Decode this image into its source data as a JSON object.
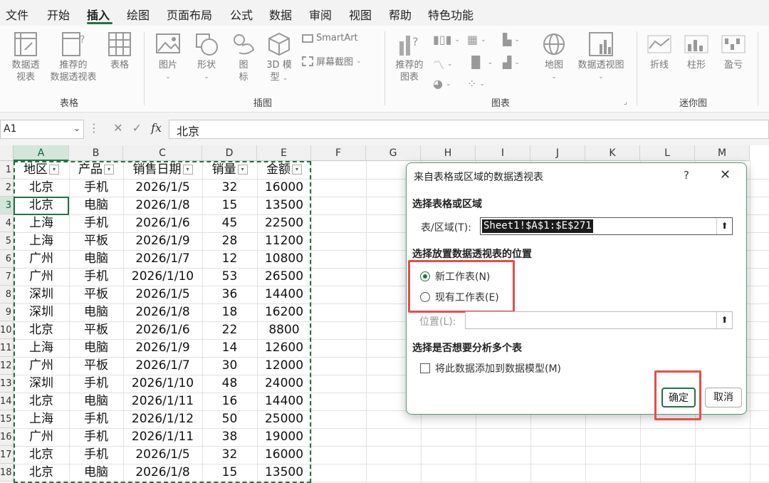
{
  "menu": {
    "tabs": [
      "文件",
      "开始",
      "插入",
      "绘图",
      "页面布局",
      "公式",
      "数据",
      "审阅",
      "视图",
      "帮助",
      "特色功能"
    ],
    "active_index": 2
  },
  "ribbon": {
    "groups": {
      "table": {
        "label": "表格",
        "pivot_line1": "数据透",
        "pivot_line2": "视表",
        "recommended_line1": "推荐的",
        "recommended_line2": "数据透视表",
        "table": "表格"
      },
      "illustrations": {
        "label": "插图",
        "picture": "图片",
        "shapes": "形状",
        "icons_line1": "图",
        "icons_line2": "标",
        "model3d_line1": "3D 模",
        "model3d_line2": "型",
        "smartart": "SmartArt",
        "screenshot": "屏幕截图"
      },
      "charts": {
        "label": "图表",
        "recommended_line1": "推荐的",
        "recommended_line2": "图表",
        "map": "地图",
        "pivot_chart": "数据透视图"
      },
      "sparklines": {
        "label": "迷你图",
        "line": "折线",
        "column": "柱形",
        "winloss": "盈亏"
      }
    }
  },
  "formula_bar": {
    "name_box": "A1",
    "fx": "fx",
    "value": "北京"
  },
  "sheet": {
    "columns": [
      "A",
      "B",
      "C",
      "D",
      "E",
      "F",
      "G",
      "H",
      "I",
      "J",
      "K",
      "L",
      "M"
    ],
    "row_numbers": [
      "1",
      "2",
      "3",
      "4",
      "5",
      "6",
      "7",
      "8",
      "9",
      "10",
      "11",
      "12",
      "13",
      "14",
      "15",
      "16",
      "17",
      "18"
    ],
    "headers": [
      "地区",
      "产品",
      "销售日期",
      "销量",
      "金额"
    ],
    "rows": [
      [
        "北京",
        "手机",
        "2026/1/5",
        "32",
        "16000"
      ],
      [
        "北京",
        "电脑",
        "2026/1/8",
        "15",
        "13500"
      ],
      [
        "上海",
        "手机",
        "2026/1/6",
        "45",
        "22500"
      ],
      [
        "上海",
        "平板",
        "2026/1/9",
        "28",
        "11200"
      ],
      [
        "广州",
        "电脑",
        "2026/1/7",
        "12",
        "10800"
      ],
      [
        "广州",
        "手机",
        "2026/1/10",
        "53",
        "26500"
      ],
      [
        "深圳",
        "平板",
        "2026/1/5",
        "36",
        "14400"
      ],
      [
        "深圳",
        "电脑",
        "2026/1/8",
        "18",
        "16200"
      ],
      [
        "北京",
        "平板",
        "2026/1/6",
        "22",
        "8800"
      ],
      [
        "上海",
        "电脑",
        "2026/1/9",
        "14",
        "12600"
      ],
      [
        "广州",
        "平板",
        "2026/1/7",
        "30",
        "12000"
      ],
      [
        "深圳",
        "手机",
        "2026/1/10",
        "48",
        "24000"
      ],
      [
        "北京",
        "电脑",
        "2026/1/11",
        "16",
        "14400"
      ],
      [
        "上海",
        "手机",
        "2026/1/12",
        "50",
        "25000"
      ],
      [
        "广州",
        "手机",
        "2026/1/11",
        "38",
        "19000"
      ],
      [
        "北京",
        "手机",
        "2026/1/5",
        "32",
        "16000"
      ],
      [
        "北京",
        "电脑",
        "2026/1/8",
        "15",
        "13500"
      ]
    ]
  },
  "dialog": {
    "title": "来自表格或区域的数据透视表",
    "help": "?",
    "close": "✕",
    "section_source": "选择表格或区域",
    "range_label": "表/区域(T):",
    "range_value": "Sheet1!$A$1:$E$271",
    "section_location": "选择放置数据透视表的位置",
    "option_new": "新工作表(N)",
    "option_existing": "现有工作表(E)",
    "location_label": "位置(L):",
    "section_multi": "选择是否想要分析多个表",
    "data_model_label": "将此数据添加到数据模型(M)",
    "ok": "确定",
    "cancel": "取消"
  }
}
